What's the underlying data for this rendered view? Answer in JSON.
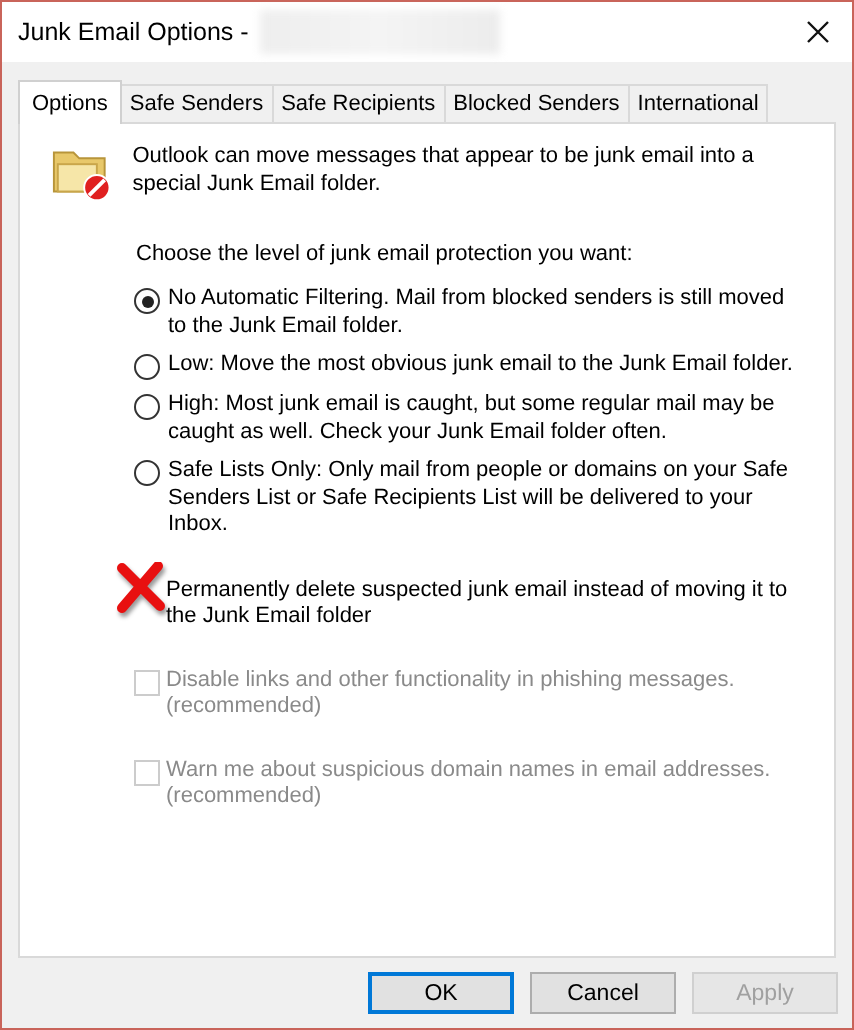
{
  "window": {
    "title": "Junk Email Options -",
    "title_redacted": true
  },
  "tabs": [
    {
      "label": "Options",
      "selected": true
    },
    {
      "label": "Safe Senders",
      "selected": false
    },
    {
      "label": "Safe Recipients",
      "selected": false
    },
    {
      "label": "Blocked Senders",
      "selected": false
    },
    {
      "label": "International",
      "selected": false
    }
  ],
  "intro": "Outlook can move messages that appear to be junk email into a special Junk Email folder.",
  "prompt": "Choose the level of junk email protection you want:",
  "levels": [
    {
      "label": "No Automatic Filtering. Mail from blocked senders is still moved to the Junk Email folder.",
      "selected": true
    },
    {
      "label": "Low: Move the most obvious junk email to the Junk Email folder.",
      "selected": false
    },
    {
      "label": "High: Most junk email is caught, but some regular mail may be caught as well. Check your Junk Email folder often.",
      "selected": false
    },
    {
      "label": "Safe Lists Only: Only mail from people or domains on your Safe Senders List or Safe Recipients List will be delivered to your Inbox.",
      "selected": false
    }
  ],
  "options": [
    {
      "label": "Permanently delete suspected junk email instead of moving it to the Junk Email folder",
      "disabled": false,
      "crossed_out": true
    },
    {
      "label": "Disable links and other functionality in phishing messages. (recommended)",
      "checked": false,
      "disabled": true,
      "crossed_out": false
    },
    {
      "label": "Warn me about suspicious domain names in email addresses. (recommended)",
      "checked": false,
      "disabled": true,
      "crossed_out": false
    }
  ],
  "buttons": [
    {
      "label": "OK",
      "kind": "default",
      "disabled": false
    },
    {
      "label": "Cancel",
      "kind": "normal",
      "disabled": false
    },
    {
      "label": "Apply",
      "kind": "normal",
      "disabled": true
    }
  ]
}
